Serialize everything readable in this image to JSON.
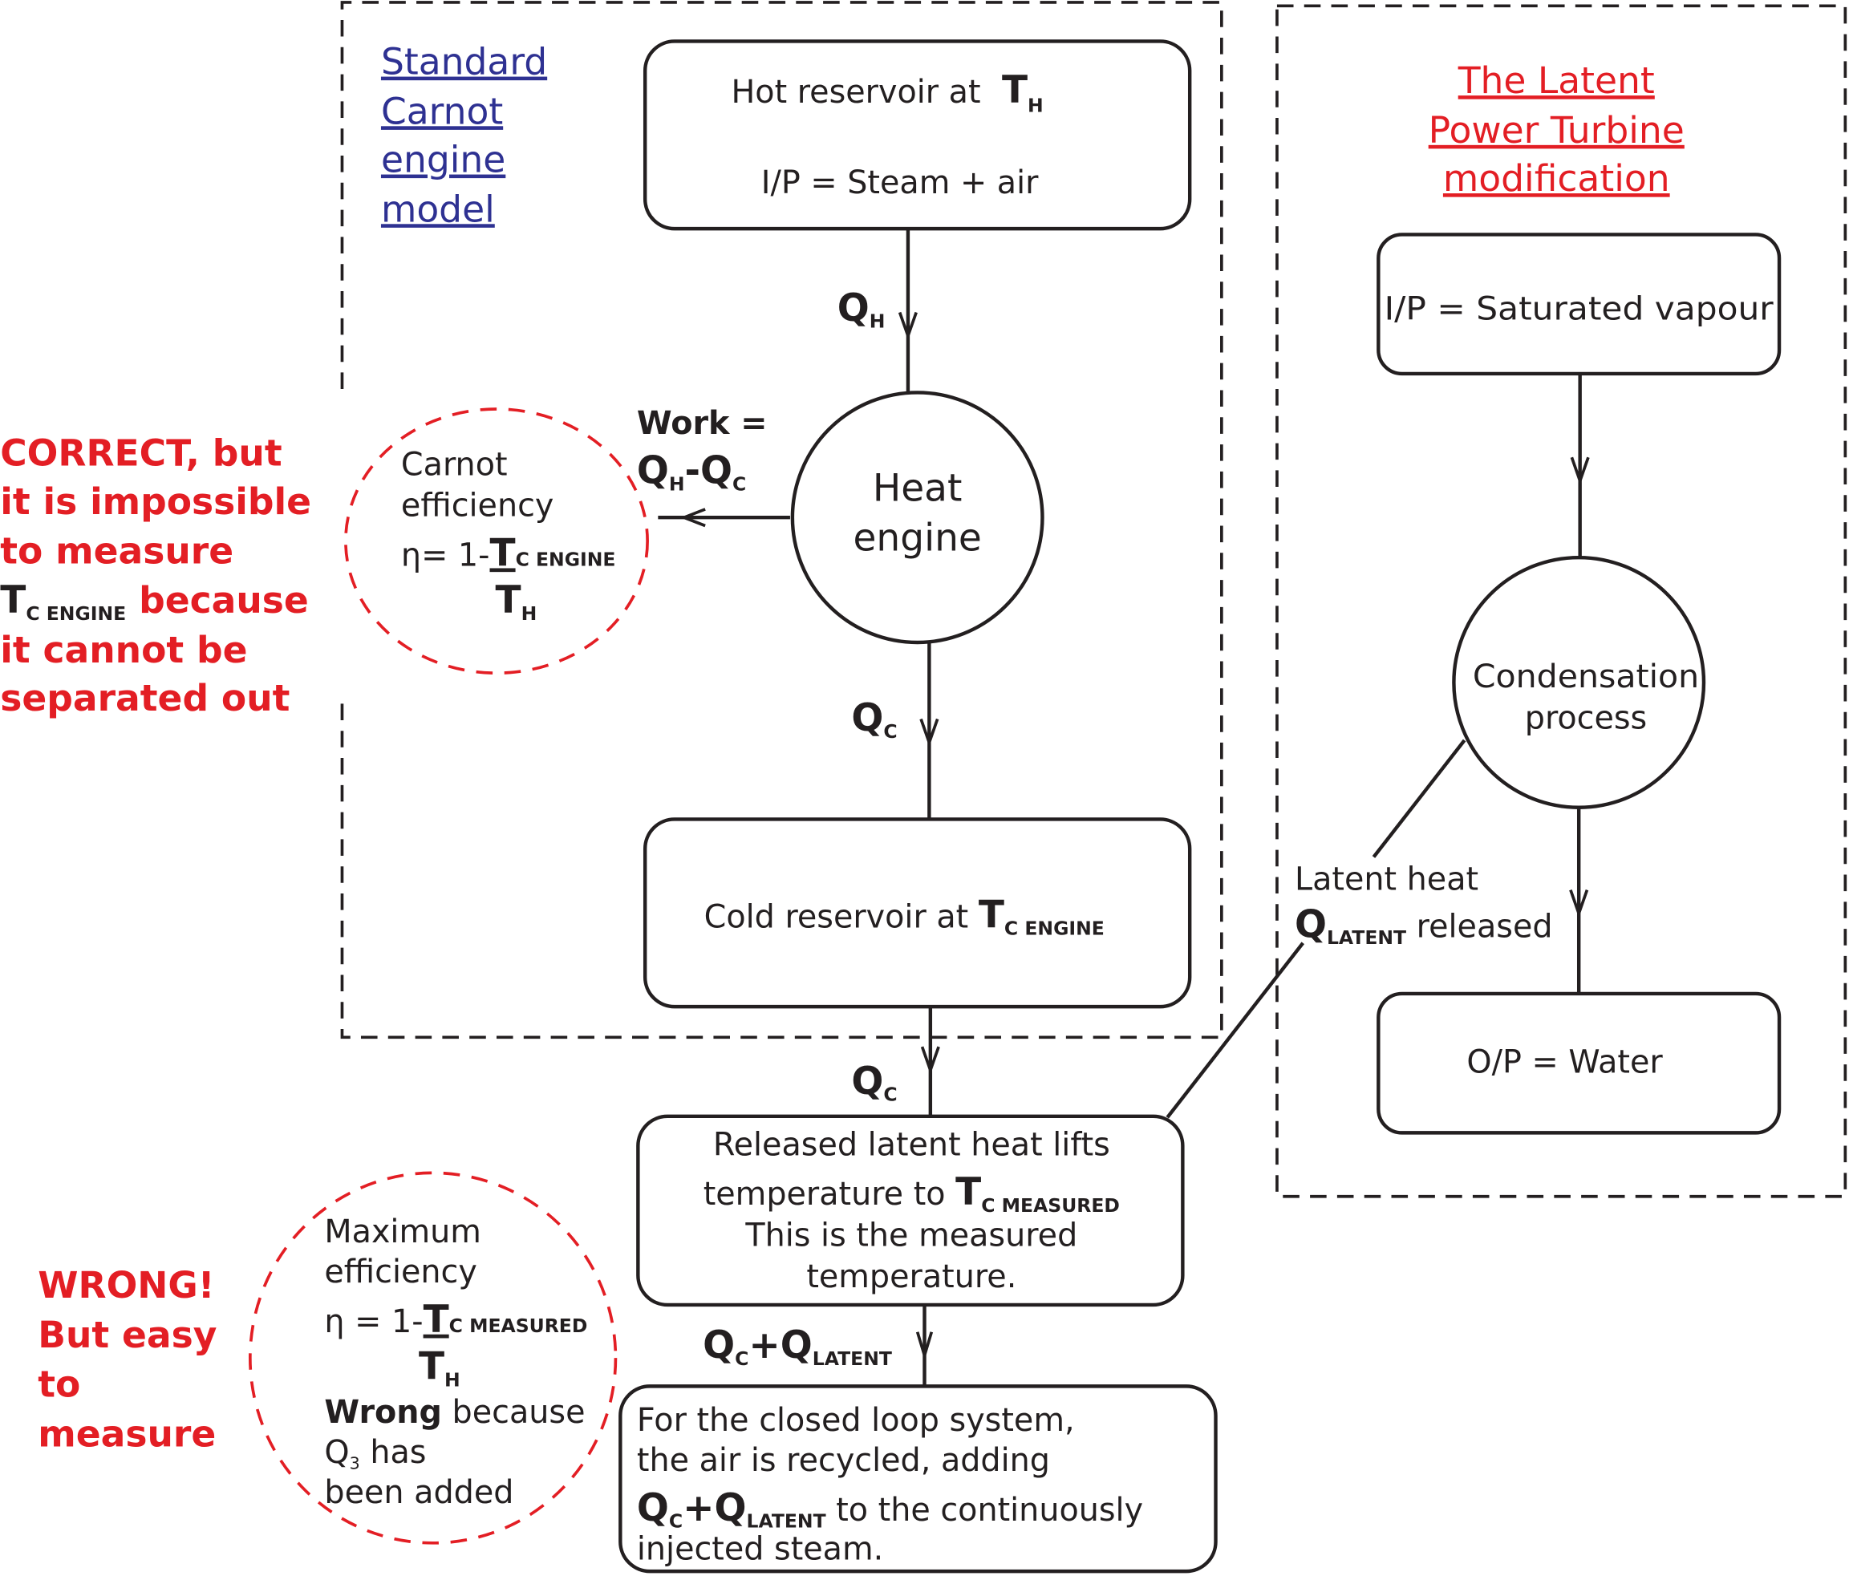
{
  "colors": {
    "red": "#e31e24",
    "blue": "#2e3192",
    "ink": "#231f20"
  },
  "standard_title": [
    "Standard",
    "Carnot",
    "engine",
    "model"
  ],
  "hot_box": {
    "line1": "Hot reservoir at",
    "T": "T",
    "T_sub": "H",
    "line2": "I/P = Steam + air"
  },
  "qh_label": {
    "Q": "Q",
    "sub": "H"
  },
  "heat_engine": [
    "Heat",
    "engine"
  ],
  "work": {
    "line1": "Work =",
    "Q1": "Q",
    "sub1": "H",
    "dash": "-",
    "Q2": "Q",
    "sub2": "C"
  },
  "carnot": {
    "line1": "Carnot",
    "line2": "efficiency",
    "eta": "η= 1-",
    "T": "T",
    "T_sub": "C ENGINE",
    "TH": "T",
    "TH_sub": "H"
  },
  "correct_note": {
    "lines": [
      "CORRECT, but",
      "it is impossible",
      "to measure"
    ],
    "T": "T",
    "T_sub": "C ENGINE",
    "because": " because",
    "lines2": [
      "it cannot be",
      "separated out"
    ]
  },
  "qc_label": {
    "Q": "Q",
    "sub": "C"
  },
  "cold_box": {
    "text": "Cold reservoir at ",
    "T": "T",
    "T_sub": "C ENGINE"
  },
  "released_box": {
    "line1": "Released  latent heat lifts",
    "line2": "temperature to ",
    "T": "T",
    "T_sub": "C MEASURED",
    "line3": "This is the measured",
    "line4": "temperature."
  },
  "qc_latent": {
    "Q1": "Q",
    "sub1": "C",
    "plus": "+",
    "Q2": "Q",
    "sub2": "LATENT"
  },
  "closed_loop": {
    "line1": "For the closed loop system,",
    "line2": "the air is recycled, adding",
    "Q1": "Q",
    "sub1": "C",
    "plus": "+",
    "Q2": "Q",
    "sub2": "LATENT",
    "rest": " to the continuously",
    "line4": "injected steam."
  },
  "max_eff": {
    "line1": "Maximum",
    "line2": "efficiency",
    "eta": "η = 1-",
    "T": "T",
    "T_sub": "C MEASURED",
    "TH": "T",
    "TH_sub": "H",
    "wrong": "Wrong",
    "because": " because",
    "q3": "Q",
    "q3_sub": "3",
    "has": " has",
    "line_last": "been added"
  },
  "wrong_note": [
    "WRONG!",
    "But easy",
    "to",
    "measure"
  ],
  "latent_title": [
    "The Latent",
    "Power Turbine",
    "modification"
  ],
  "sat_box": "I/P = Saturated vapour",
  "condensation": [
    "Condensation",
    "process"
  ],
  "water_box": "O/P = Water",
  "latent_label": {
    "line1": "Latent heat",
    "Q": "Q",
    "sub": "LATENT",
    "rest": " released"
  }
}
